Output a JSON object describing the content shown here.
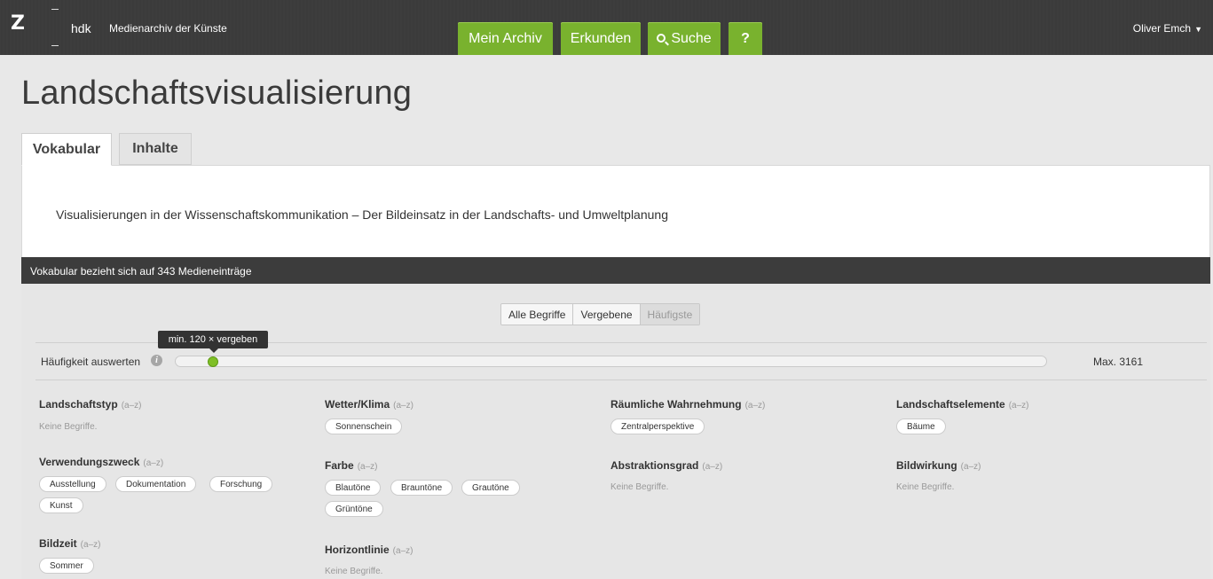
{
  "header": {
    "logo_z": "Z",
    "logo_hdk": "hdk",
    "app_title": "Medienarchiv der Künste",
    "nav": [
      "Mein Archiv",
      "Erkunden",
      "Suche",
      "?"
    ],
    "user": "Oliver Emch",
    "user_caret": "▼"
  },
  "page": {
    "title": "Landschaftsvisualisierung",
    "tabs": [
      "Vokabular",
      "Inhalte"
    ],
    "description": "Visualisierungen in der Wissenschaftskommunikation – Der Bildeinsatz in der Landschafts- und Umweltplanung",
    "bar_text": "Vokabular bezieht sich auf 343 Medieneinträge"
  },
  "filter": {
    "segments": [
      "Alle Begriffe",
      "Vergebene",
      "Häufigste"
    ],
    "tooltip": "min. 120 × vergeben",
    "label": "Häufigkeit auswerten",
    "info": "i",
    "max": "Max. 3161",
    "slider_min": 0,
    "slider_max": 3161,
    "slider_value": 120
  },
  "groups": [
    {
      "title": "Landschaftstyp",
      "az": "(a–z)",
      "empty": "Keine Begriffe.",
      "terms": []
    },
    {
      "title": "Wetter/Klima",
      "az": "(a–z)",
      "terms": [
        "Sonnenschein"
      ]
    },
    {
      "title": "Räumliche Wahrnehmung",
      "az": "(a–z)",
      "terms": [
        "Zentralperspektive"
      ]
    },
    {
      "title": "Landschaftselemente",
      "az": "(a–z)",
      "terms": [
        "Bäume"
      ]
    },
    {
      "title": "Verwendungszweck",
      "az": "(a–z)",
      "terms": [
        "Ausstellung",
        "Dokumentation",
        "Forschung",
        "Kunst"
      ]
    },
    {
      "title": "Farbe",
      "az": "(a–z)",
      "terms": [
        "Blautöne",
        "Brauntöne",
        "Grautöne",
        "Grüntöne"
      ]
    },
    {
      "title": "Abstraktionsgrad",
      "az": "(a–z)",
      "empty": "Keine Begriffe.",
      "terms": []
    },
    {
      "title": "Bildwirkung",
      "az": "(a–z)",
      "empty": "Keine Begriffe.",
      "terms": []
    },
    {
      "title": "Bildzeit",
      "az": "(a–z)",
      "terms": [
        "Sommer"
      ]
    },
    {
      "title": "Horizontlinie",
      "az": "(a–z)",
      "empty": "Keine Begriffe.",
      "terms": []
    }
  ],
  "colors": {
    "accent": "#79b22e",
    "topbar": "#3c3c3c",
    "slider_knob": "#7fbf26"
  }
}
